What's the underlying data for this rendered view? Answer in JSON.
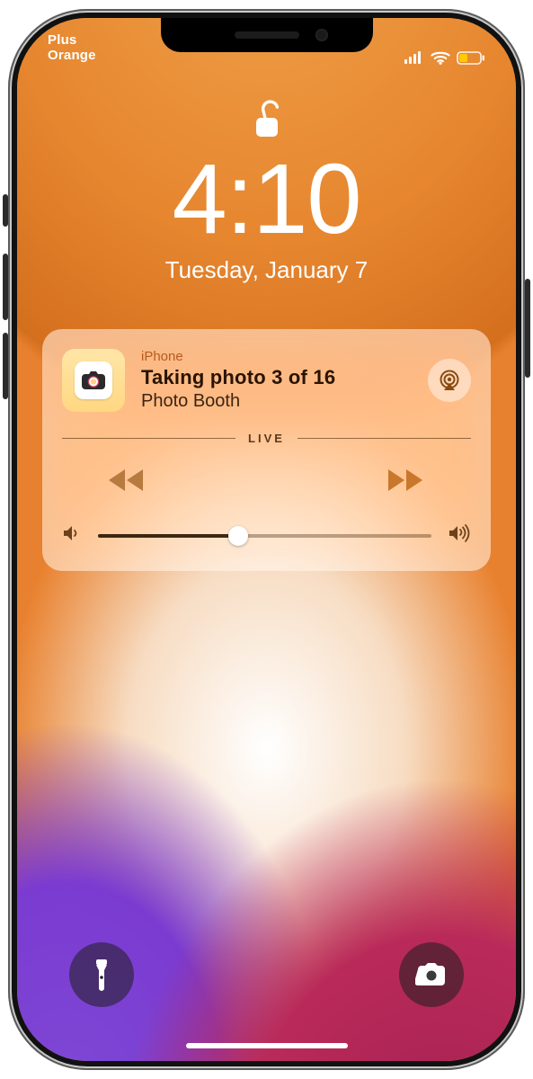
{
  "status": {
    "carrier_line1": "Plus",
    "carrier_line2": "Orange"
  },
  "lock": {
    "time": "4:10",
    "date": "Tuesday, January 7"
  },
  "now_playing": {
    "device": "iPhone",
    "title": "Taking photo 3 of 16",
    "app": "Photo Booth",
    "live_label": "LIVE",
    "volume_percent": 42
  },
  "icons": {
    "lock": "unlock-icon",
    "airplay": "airplay-icon",
    "rewind": "rewind-icon",
    "stop": "stop-icon",
    "forward": "forward-icon",
    "vol_low": "volume-low-icon",
    "vol_high": "volume-high-icon",
    "flashlight": "flashlight-icon",
    "camera": "camera-icon",
    "signal": "cellular-icon",
    "wifi": "wifi-icon",
    "battery": "battery-icon",
    "camera_app": "camera-app-icon"
  }
}
